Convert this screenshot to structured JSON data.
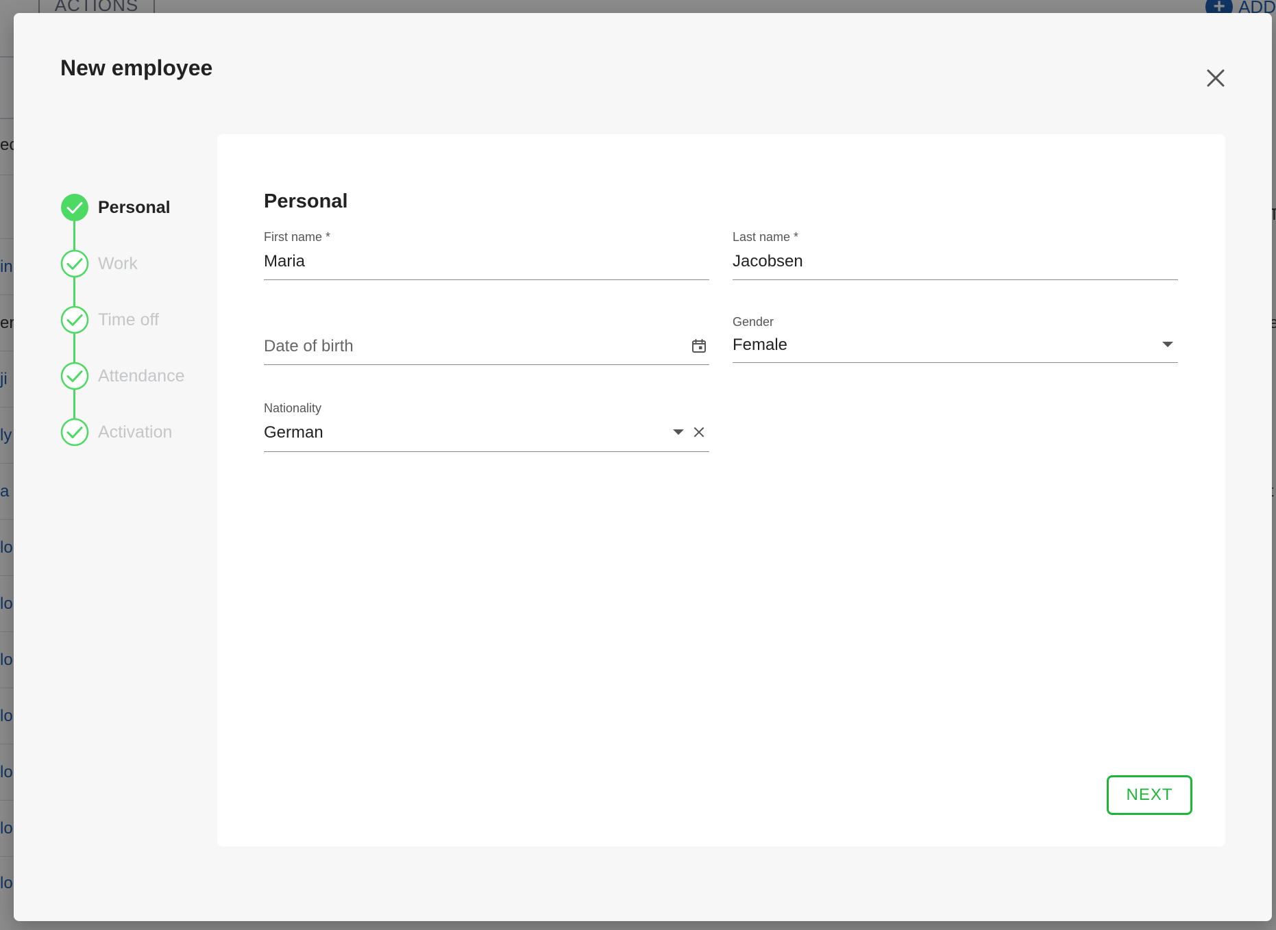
{
  "background": {
    "actions_label": "ACTIONS",
    "add_label": "ADD",
    "row_fragments": [
      "ec",
      "in",
      "ert",
      "ji",
      "ly",
      "a",
      "lo",
      "lo",
      "lo",
      "lo",
      "lo",
      "lo",
      "lo"
    ],
    "right_fragments": [
      "T",
      "e",
      "t"
    ]
  },
  "dialog": {
    "title": "New employee",
    "close_icon": "close-icon"
  },
  "stepper": {
    "steps": [
      {
        "label": "Personal",
        "state": "active-completed"
      },
      {
        "label": "Work",
        "state": "completed"
      },
      {
        "label": "Time off",
        "state": "completed"
      },
      {
        "label": "Attendance",
        "state": "completed"
      },
      {
        "label": "Activation",
        "state": "completed"
      }
    ],
    "accent_color": "#4cd964"
  },
  "form": {
    "section_title": "Personal",
    "first_name": {
      "label": "First name *",
      "value": "Maria"
    },
    "last_name": {
      "label": "Last name *",
      "value": "Jacobsen"
    },
    "date_of_birth": {
      "placeholder": "Date of birth",
      "value": "",
      "icon": "calendar-icon"
    },
    "gender": {
      "label": "Gender",
      "value": "Female",
      "icon": "chevron-down-icon"
    },
    "nationality": {
      "label": "Nationality",
      "value": "German",
      "icons": [
        "chevron-down-icon",
        "clear-icon"
      ]
    },
    "next_label": "NEXT",
    "next_color": "#1fb53a"
  }
}
